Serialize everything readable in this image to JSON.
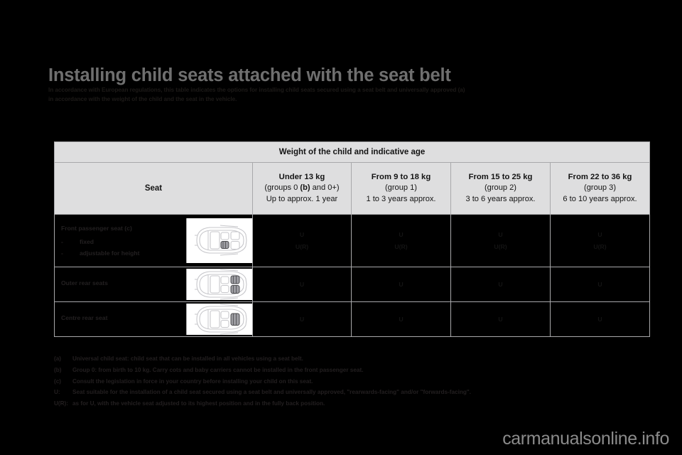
{
  "header": {
    "title": "Installing child seats attached with the seat belt",
    "subtitle_line1": "In accordance with European regulations, this table indicates the options for installing child seats secured using a seat belt and universally approved (a)",
    "subtitle_line2": "in accordance with the weight of the child and the seat in the vehicle."
  },
  "table": {
    "top_header": "Weight of the child and indicative age",
    "seat_header": "Seat",
    "weight_columns": [
      {
        "line1": "Under 13 kg",
        "line2_prefix": "(groups 0 ",
        "line2_bold": "(b)",
        "line2_suffix": " and 0+)",
        "line3": "Up to approx. 1 year"
      },
      {
        "line1": "From 9 to 18 kg",
        "line2": "(group 1)",
        "line3": "1 to 3 years approx."
      },
      {
        "line1": "From 15 to 25 kg",
        "line2": "(group 2)",
        "line3": "3 to 6 years approx."
      },
      {
        "line1": "From 22 to 36 kg",
        "line2": "(group 3)",
        "line3": "6 to 10 years approx."
      }
    ],
    "rows": [
      {
        "title": "Front passenger seat (c)",
        "bullet1": "fixed",
        "bullet2": "adjustable for height",
        "bullet_dash": "-",
        "diagram": "car-top-view-front-passenger",
        "values": [
          {
            "v1": "U",
            "v2": "U(R)"
          },
          {
            "v1": "U",
            "v2": "U(R)"
          },
          {
            "v1": "U",
            "v2": "U(R)"
          },
          {
            "v1": "U",
            "v2": "U(R)"
          }
        ]
      },
      {
        "title": "Outer rear seats",
        "diagram": "car-top-view-outer-rear",
        "values": [
          {
            "v1": "U"
          },
          {
            "v1": "U"
          },
          {
            "v1": "U"
          },
          {
            "v1": "U"
          }
        ]
      },
      {
        "title": "Centre rear seat",
        "diagram": "car-top-view-centre-rear",
        "values": [
          {
            "v1": "U"
          },
          {
            "v1": "U"
          },
          {
            "v1": "U"
          },
          {
            "v1": "U"
          }
        ]
      }
    ]
  },
  "footnotes": [
    {
      "key": "(a)",
      "text": "Universal child seat: child seat that can be installed in all vehicles using a seat belt."
    },
    {
      "key": "(b)",
      "text": "Group 0: from birth to 10 kg. Carry cots and baby carriers cannot be installed in the front passenger seat."
    },
    {
      "key": "(c)",
      "text": "Consult the legislation in force in your country before installing your child on this seat."
    },
    {
      "key": "U:",
      "text": "Seat suitable for the installation of a child seat secured using a seat belt and universally approved, \"rearwards-facing\" and/or \"forwards-facing\"."
    },
    {
      "key": "U(R):",
      "text": "as for U, with the vehicle seat adjusted to its highest position and in the fully back position."
    }
  ],
  "watermark": "carmanualsonline.info",
  "colors": {
    "background": "#000000",
    "title": "#6f6f6f",
    "table_bg": "#dededf",
    "table_border": "#a8a8aa",
    "body_text": "#231f20"
  }
}
